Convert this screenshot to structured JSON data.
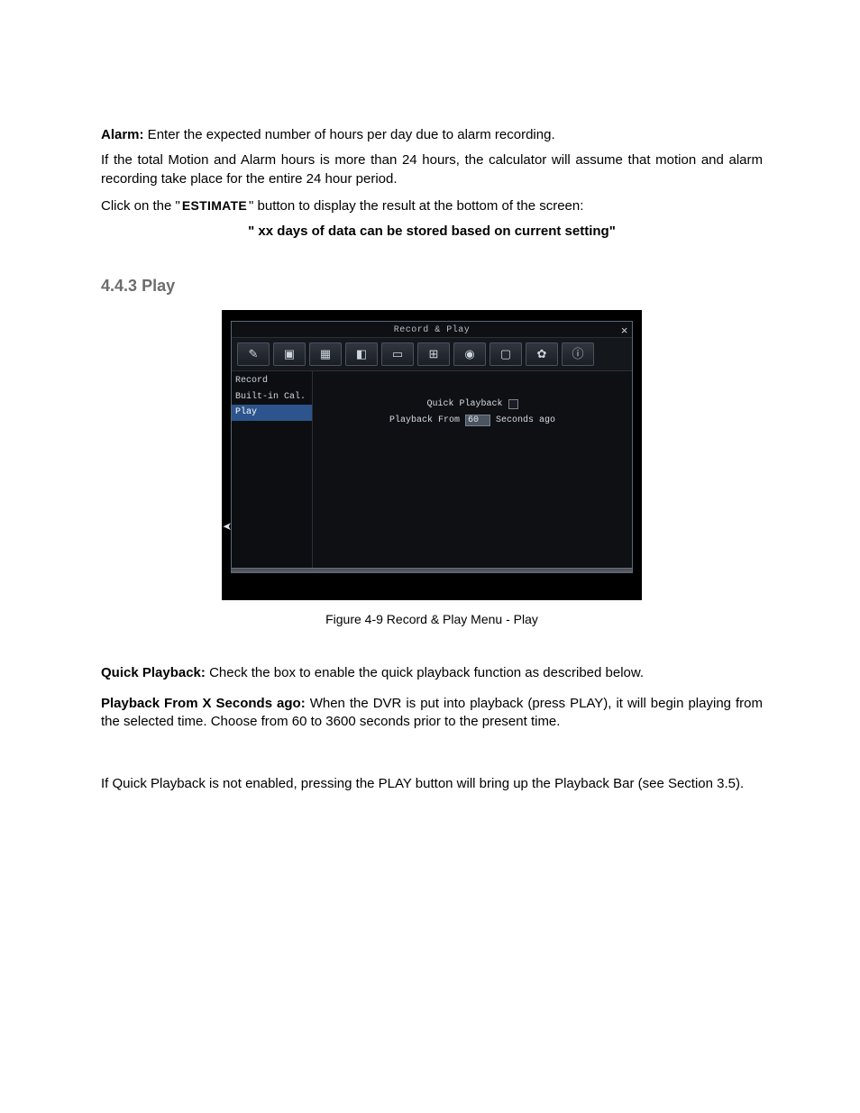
{
  "intro": {
    "alarm_label": "Alarm:",
    "alarm_text": " Enter the expected number of hours per day due to alarm recording.",
    "overflow_text": "If the total Motion and Alarm hours is more than 24 hours, the calculator will assume that motion and alarm recording take place for the entire 24 hour period.",
    "click_prefix": "Click on the \"",
    "estimate_button": "ESTIMATE",
    "click_suffix": "\" button to display the result at the bottom of the screen:",
    "result_line": "\" xx days of data can be stored based on current setting\""
  },
  "section": {
    "number": "4.4.3",
    "title": "Play"
  },
  "app": {
    "window_title": "Record & Play",
    "close_label": "×",
    "toolbar_icons": [
      "brush-icon",
      "video-icon",
      "calendar-icon",
      "bell-icon",
      "screen-icon",
      "network-icon",
      "camera-icon",
      "display-icon",
      "gear-icon",
      "info-icon"
    ],
    "sidebar": {
      "items": [
        {
          "label": "Record"
        },
        {
          "label": "Built-in Cal."
        },
        {
          "label": "Play"
        }
      ],
      "selected_index": 2
    },
    "fields": {
      "quick_playback_label": "Quick Playback",
      "playback_from_label": "Playback From",
      "playback_value": "60",
      "seconds_ago_label": "Seconds ago"
    }
  },
  "figure_caption": "Figure 4-9 Record & Play Menu - Play",
  "body": {
    "qp_label": "Quick Playback:",
    "qp_text": " Check the box to enable the quick playback function as described below.",
    "pf_label": "Playback From X Seconds ago:",
    "pf_text": " When the DVR is put into playback (press PLAY), it will begin playing from the selected time. Choose from 60 to 3600 seconds prior to the present time.",
    "note_text": "If Quick Playback is not enabled, pressing the PLAY button will bring up the Playback Bar (see Section 3.5)."
  }
}
